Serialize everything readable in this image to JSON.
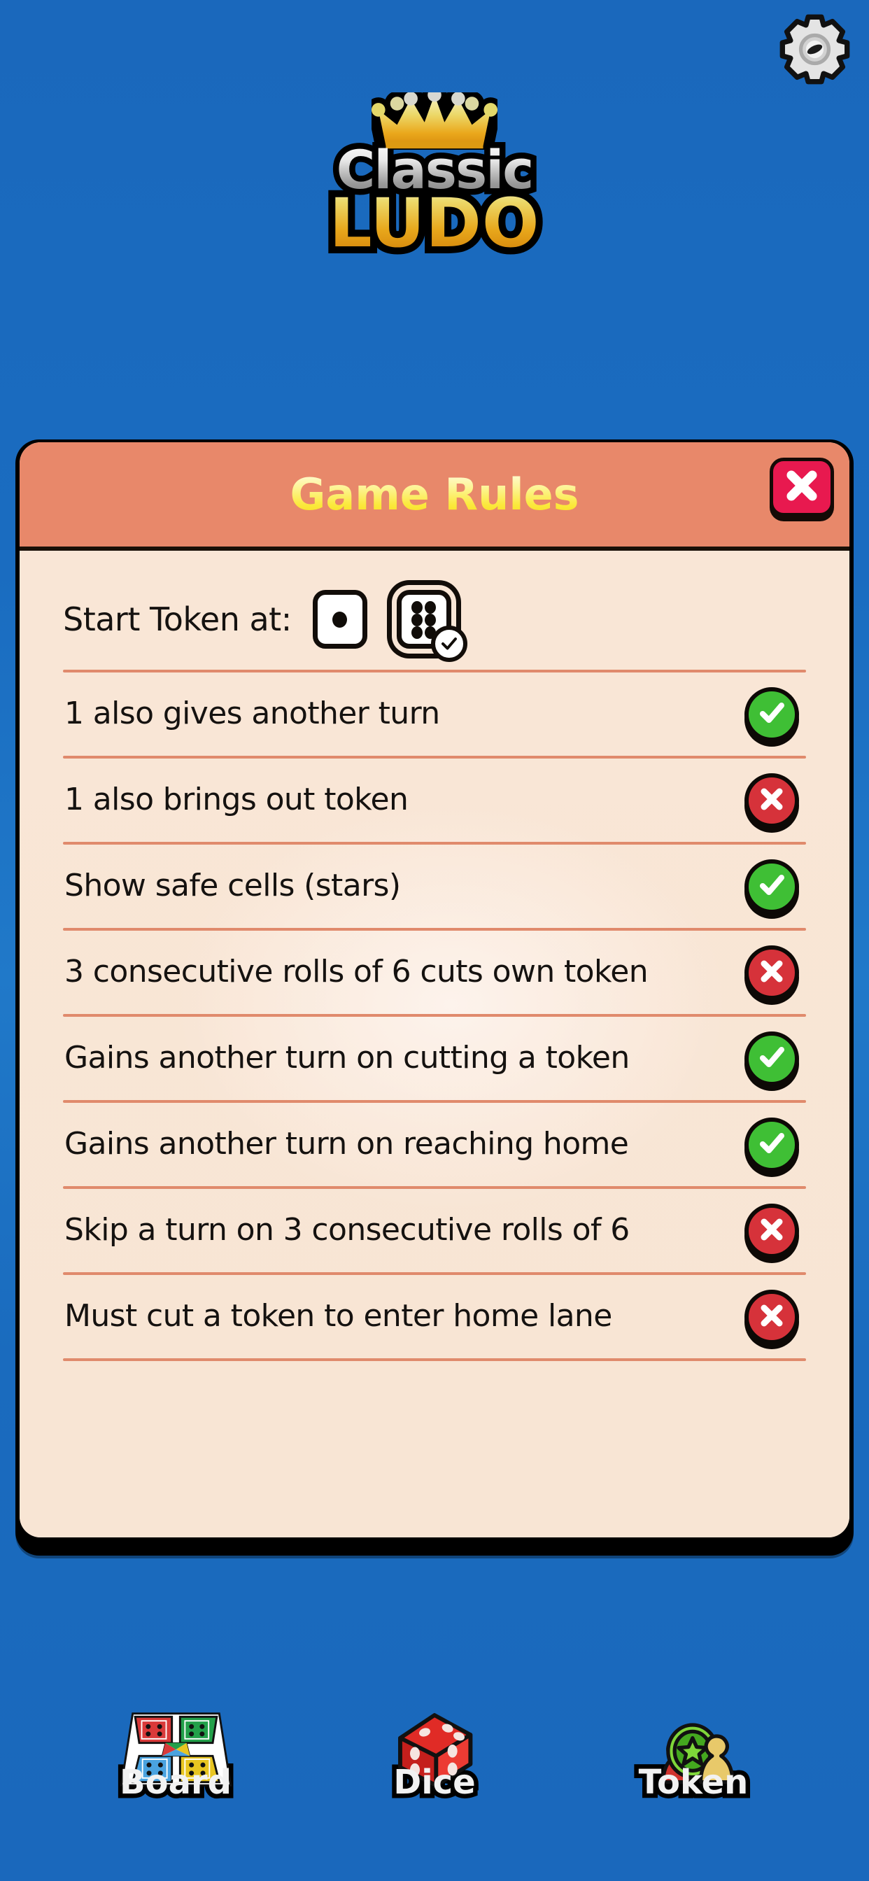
{
  "app": {
    "logo_top": "Classic",
    "logo_bottom": "LUDO",
    "background_color": "#1a68bc"
  },
  "header": {
    "settings_icon": "gear-icon"
  },
  "dialog": {
    "title": "Game Rules",
    "title_color": "#fbe93d",
    "header_bg": "#e8886a",
    "body_bg": "#f9e6d6",
    "close_icon": "close-x-icon",
    "close_bg": "#e8194f",
    "start_token": {
      "label": "Start Token at:",
      "options": [
        {
          "value": "1",
          "pips": 1,
          "selected": false
        },
        {
          "value": "6",
          "pips": 6,
          "selected": true
        }
      ]
    },
    "rules": [
      {
        "text": "1 also gives another turn",
        "enabled": true,
        "icon": "check-icon"
      },
      {
        "text": "1 also brings out token",
        "enabled": false,
        "icon": "cross-icon"
      },
      {
        "text": "Show safe cells (stars)",
        "enabled": true,
        "icon": "check-icon"
      },
      {
        "text": "3 consecutive rolls of 6 cuts own token",
        "enabled": false,
        "icon": "cross-icon"
      },
      {
        "text": "Gains another turn on cutting a token",
        "enabled": true,
        "icon": "check-icon"
      },
      {
        "text": "Gains another turn on reaching home",
        "enabled": true,
        "icon": "check-icon"
      },
      {
        "text": "Skip a turn on 3 consecutive rolls of 6",
        "enabled": false,
        "icon": "cross-icon"
      },
      {
        "text": "Must cut a token to enter home lane",
        "enabled": false,
        "icon": "cross-icon"
      }
    ],
    "toggle_on_color": "#3fbf35",
    "toggle_off_color": "#d6323a"
  },
  "bottom_nav": [
    {
      "label": "Board",
      "icon": "ludo-board-icon"
    },
    {
      "label": "Dice",
      "icon": "red-dice-icon"
    },
    {
      "label": "Token",
      "icon": "token-coin-icon"
    }
  ]
}
